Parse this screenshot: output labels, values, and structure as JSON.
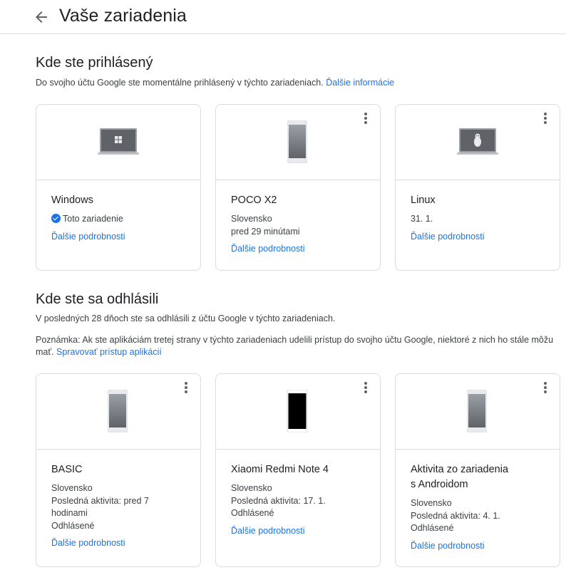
{
  "header": {
    "title": "Vaše zariadenia"
  },
  "signed_in": {
    "title": "Kde ste prihlásený",
    "description": "Do svojho účtu Google ste momentálne prihlásený v týchto zariadeniach.",
    "learn_more": "Ďalšie informácie",
    "cards": [
      {
        "name": "Windows",
        "this_device": "Toto zariadenie",
        "more": "Ďalšie podrobnosti",
        "icon": "windows-laptop-icon"
      },
      {
        "name": "POCO X2",
        "line1": "Slovensko",
        "line2": "pred 29 minútami",
        "more": "Ďalšie podrobnosti",
        "icon": "android-phone-icon"
      },
      {
        "name": "Linux",
        "line1": "31. 1.",
        "more": "Ďalšie podrobnosti",
        "icon": "linux-laptop-icon"
      }
    ]
  },
  "signed_out": {
    "title": "Kde ste sa odhlásili",
    "description": "V posledných 28 dňoch ste sa odhlásili z účtu Google v týchto zariadeniach.",
    "note": "Poznámka: Ak ste aplikáciám tretej strany v týchto zariadeniach udelili prístup do svojho účtu Google, niektoré z nich ho stále môžu mať.",
    "manage_link": "Spravovať prístup aplikácií",
    "cards": [
      {
        "name": "BASIC",
        "line1": "Slovensko",
        "line2": "Posledná aktivita: pred 7",
        "line3": "hodinami",
        "line4": "Odhlásené",
        "more": "Ďalšie podrobnosti",
        "icon": "android-phone-icon"
      },
      {
        "name": "Xiaomi Redmi Note 4",
        "line1": "Slovensko",
        "line2": "Posledná aktivita: 17. 1.",
        "line3": "Odhlásené",
        "more": "Ďalšie podrobnosti",
        "icon": "phone-black-screen-icon"
      },
      {
        "name_line1": "Aktivita zo zariadenia",
        "name_line2": "s Androidom",
        "line1": "Slovensko",
        "line2": "Posledná aktivita: 4. 1.",
        "line3": "Odhlásené",
        "more": "Ďalšie podrobnosti",
        "icon": "android-phone-icon"
      }
    ]
  }
}
